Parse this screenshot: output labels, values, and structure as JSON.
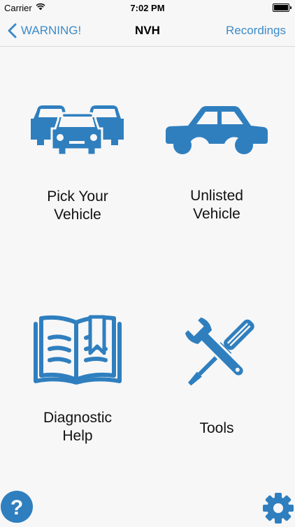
{
  "status_bar": {
    "carrier": "Carrier",
    "time": "7:02 PM"
  },
  "nav": {
    "back_label": "WARNING!",
    "title": "NVH",
    "right_label": "Recordings"
  },
  "tiles": [
    {
      "label": "Pick Your\nVehicle",
      "icon": "cars-icon"
    },
    {
      "label": "Unlisted\nVehicle",
      "icon": "car-icon"
    },
    {
      "label": "Diagnostic\nHelp",
      "icon": "book-icon"
    },
    {
      "label": "Tools",
      "icon": "tools-icon"
    }
  ],
  "bottom": {
    "help_glyph": "?"
  },
  "colors": {
    "accent": "#3c8bc9",
    "icon_blue": "#2f7fbf",
    "background": "#f7f7f7"
  }
}
